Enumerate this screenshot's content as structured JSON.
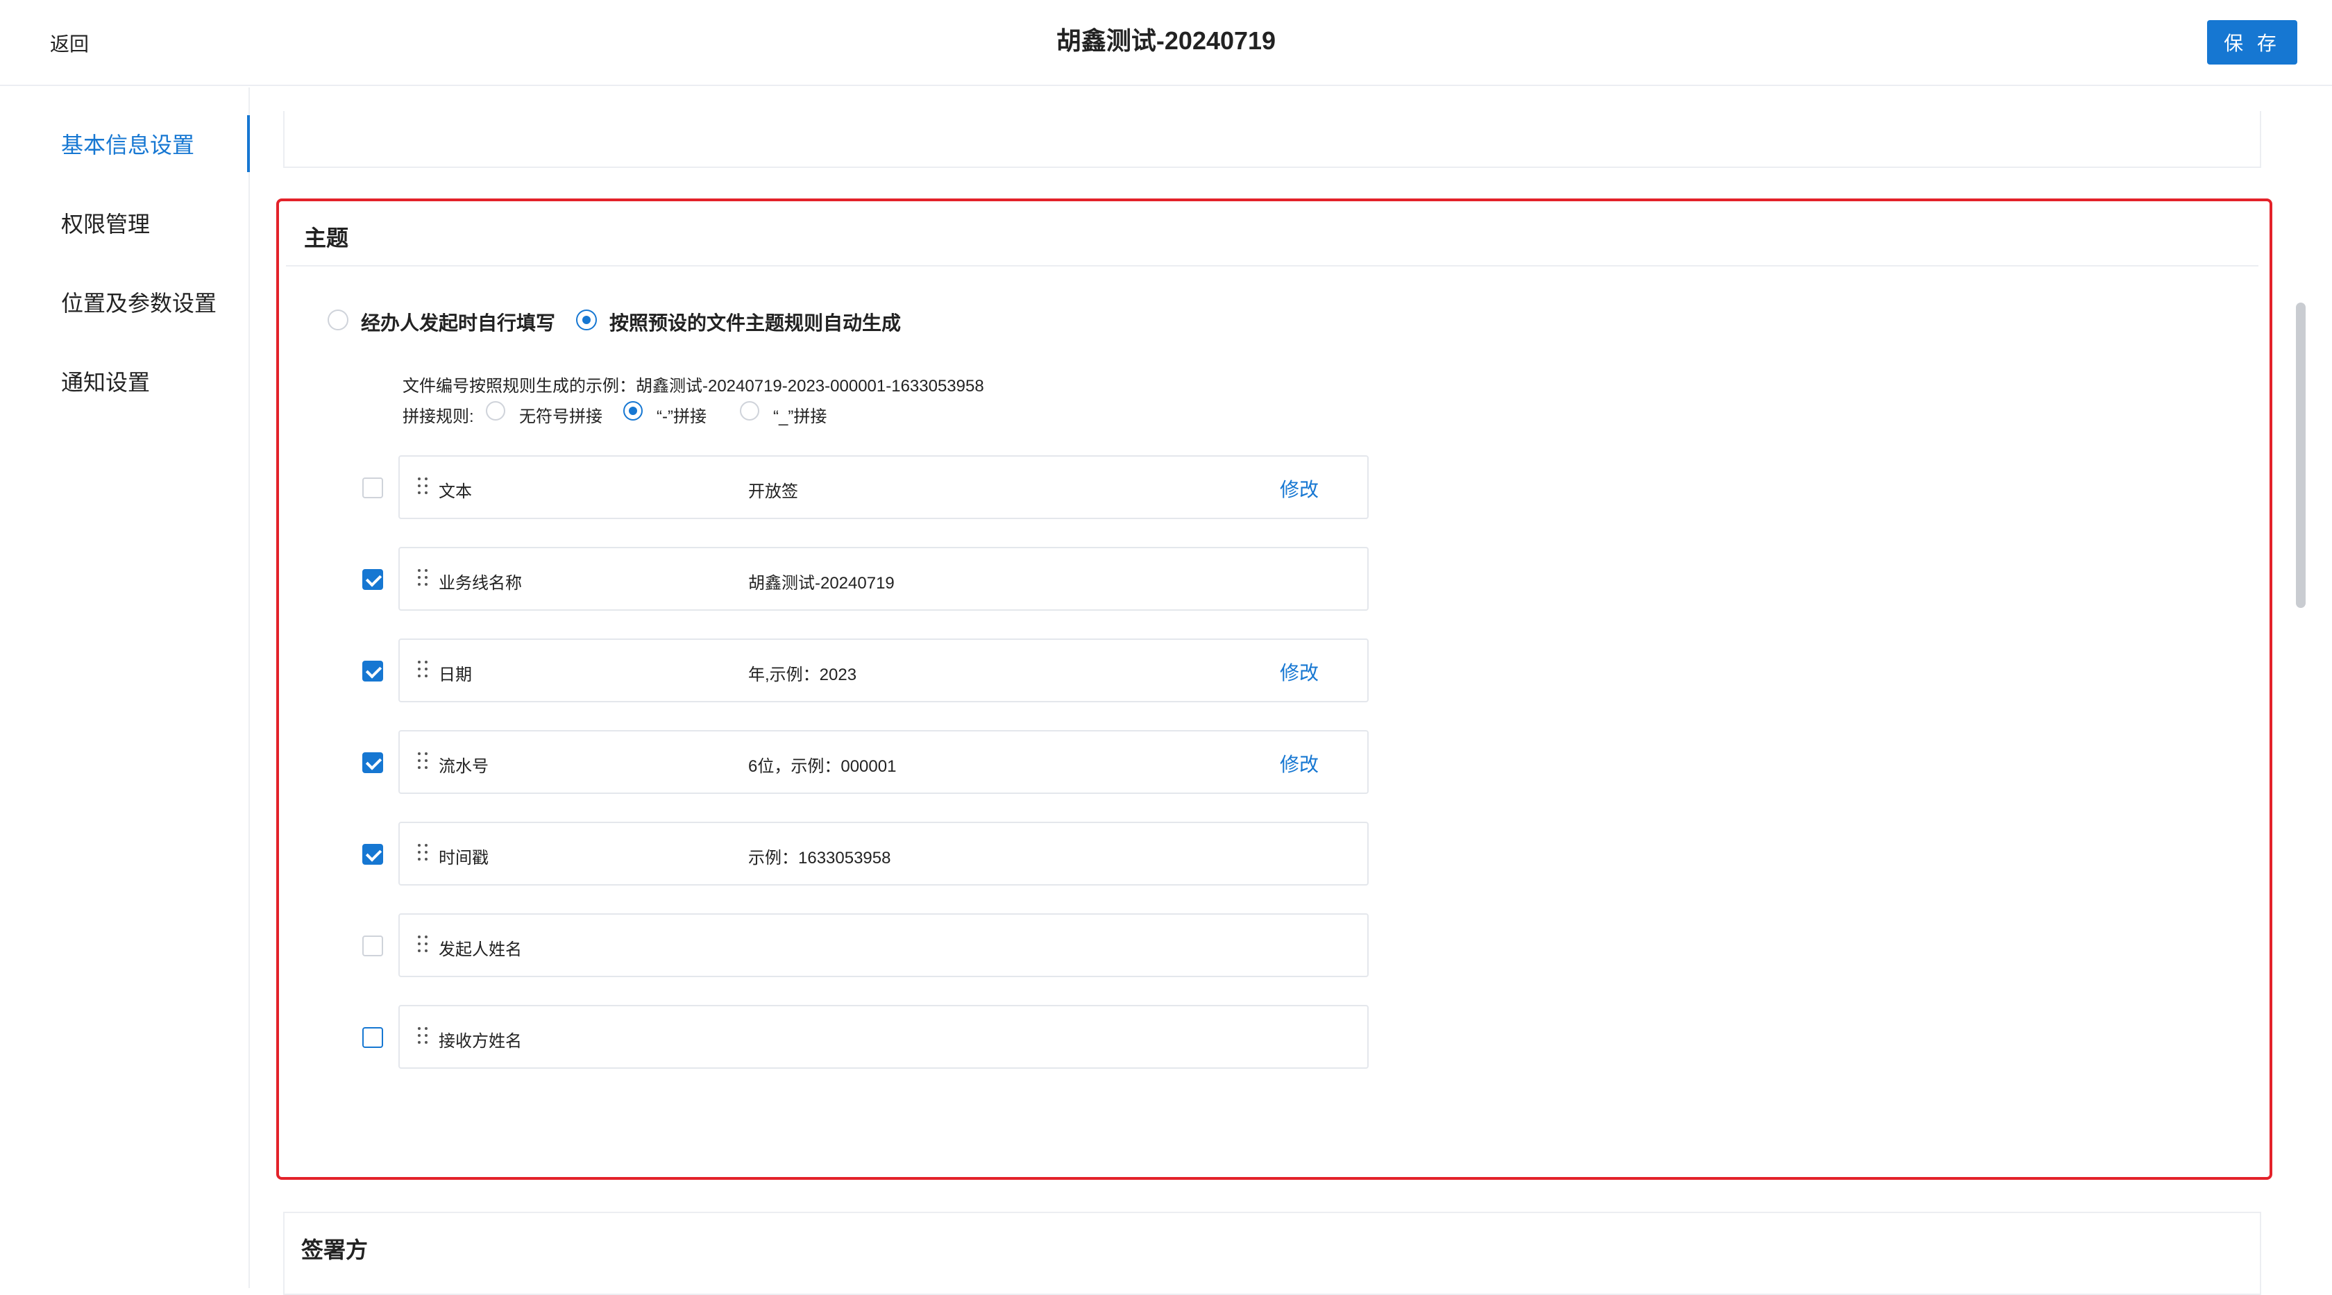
{
  "header": {
    "back_label": "返回",
    "title": "胡鑫测试-20240719",
    "save_label": "保 存"
  },
  "sidebar": {
    "items": [
      {
        "label": "基本信息设置",
        "active": true
      },
      {
        "label": "权限管理",
        "active": false
      },
      {
        "label": "位置及参数设置",
        "active": false
      },
      {
        "label": "通知设置",
        "active": false
      }
    ]
  },
  "theme": {
    "title": "主题",
    "mode_options": [
      {
        "label": "经办人发起时自行填写",
        "selected": false
      },
      {
        "label": "按照预设的文件主题规则自动生成",
        "selected": true
      }
    ],
    "example_text": "文件编号按照规则生成的示例：胡鑫测试-20240719-2023-000001-1633053958",
    "join_rule_label": "拼接规则:",
    "join_options": [
      {
        "label": "无符号拼接",
        "selected": false
      },
      {
        "label": "“-”拼接",
        "selected": true
      },
      {
        "label": "“_”拼接",
        "selected": false
      }
    ],
    "edit_label": "修改",
    "fields": [
      {
        "name": "文本",
        "value": "开放签",
        "checked": false,
        "editable": true
      },
      {
        "name": "业务线名称",
        "value": "胡鑫测试-20240719",
        "checked": true,
        "editable": false
      },
      {
        "name": "日期",
        "value": "年,示例：2023",
        "checked": true,
        "editable": true
      },
      {
        "name": "流水号",
        "value": "6位，示例：000001",
        "checked": true,
        "editable": true
      },
      {
        "name": "时间戳",
        "value": "示例：1633053958",
        "checked": true,
        "editable": false
      },
      {
        "name": "发起人姓名",
        "value": "",
        "checked": false,
        "editable": false
      },
      {
        "name": "接收方姓名",
        "value": "",
        "checked": false,
        "editable": false
      }
    ]
  },
  "next_section": {
    "title": "签署方"
  },
  "colors": {
    "accent": "#1677d2",
    "highlight_border": "#e3222a"
  },
  "icons": {
    "drag_handle": "drag-handle-icon",
    "check": "check-icon"
  }
}
